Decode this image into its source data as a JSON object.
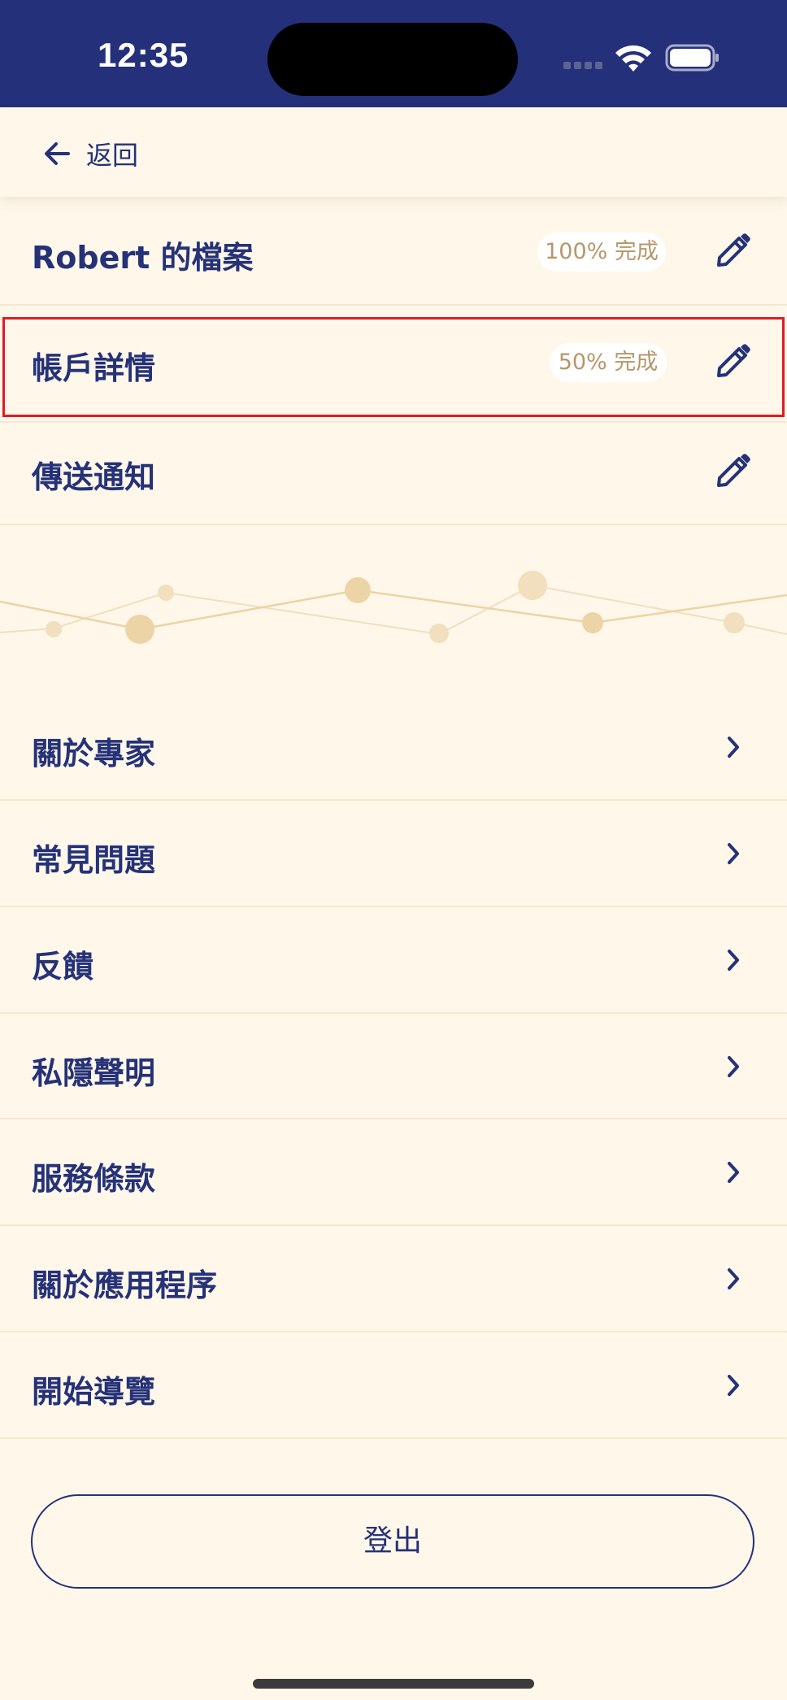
{
  "status_bar": {
    "time": "12:35"
  },
  "header": {
    "back_label": "返回"
  },
  "profile_rows": [
    {
      "label": "Robert 的檔案",
      "badge": "100% 完成",
      "action_icon": "pencil-icon"
    },
    {
      "label": "帳戶詳情",
      "badge": "50% 完成",
      "action_icon": "pencil-icon"
    },
    {
      "label": "傳送通知",
      "action_icon": "pencil-icon"
    }
  ],
  "menu_items": [
    {
      "label": "關於專家"
    },
    {
      "label": "常見問題"
    },
    {
      "label": "反饋"
    },
    {
      "label": "私隱聲明"
    },
    {
      "label": "服務條款"
    },
    {
      "label": "關於應用程序"
    },
    {
      "label": "開始導覽"
    }
  ],
  "logout_label": "登出",
  "colors": {
    "status_bar_bg": "#25307a",
    "page_bg": "#fef7ea",
    "primary_text": "#253278",
    "badge_text": "#b6976a",
    "divider": "#f6e8cd",
    "highlight_border": "#e01b24",
    "decor": "#ecd4a6"
  }
}
